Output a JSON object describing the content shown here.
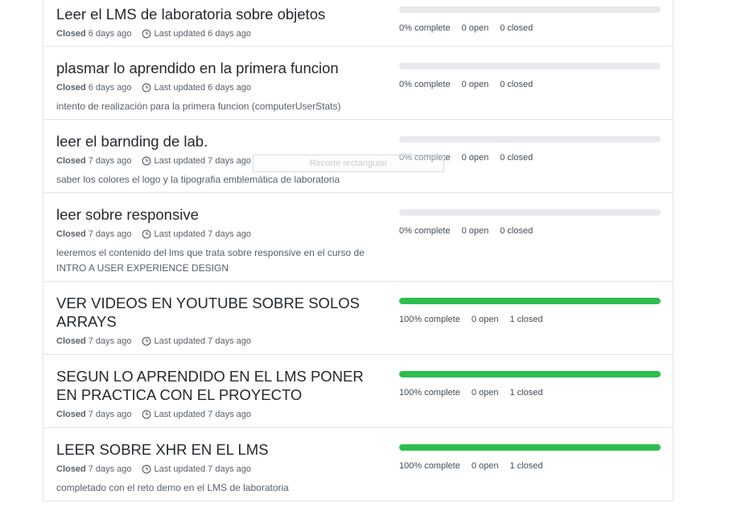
{
  "milestones": [
    {
      "title": "Leer el LMS de laboratoria sobre objetos",
      "state": "Closed",
      "closed_ago": "6 days ago",
      "updated": "Last updated 6 days ago",
      "description": "",
      "progress": 0,
      "complete": "0% complete",
      "open": "0 open",
      "closed": "0 closed"
    },
    {
      "title": "plasmar lo aprendido en la primera funcion",
      "state": "Closed",
      "closed_ago": "6 days ago",
      "updated": "Last updated 6 days ago",
      "description": "intento de realización para la primera funcion (computerUserStats)",
      "progress": 0,
      "complete": "0% complete",
      "open": "0 open",
      "closed": "0 closed"
    },
    {
      "title": "leer el barnding de lab.",
      "state": "Closed",
      "closed_ago": "7 days ago",
      "updated": "Last updated 7 days ago",
      "description": "saber los colores el logo y la tipografia emblemática de laboratoria",
      "progress": 0,
      "complete": "0% complete",
      "open": "0 open",
      "closed": "0 closed"
    },
    {
      "title": "leer sobre responsive",
      "state": "Closed",
      "closed_ago": "7 days ago",
      "updated": "Last updated 7 days ago",
      "description": "leeremos el contenido del lms que trata sobre responsive en el curso de INTRO A USER EXPERIENCE DESIGN",
      "progress": 0,
      "complete": "0% complete",
      "open": "0 open",
      "closed": "0 closed"
    },
    {
      "title": "VER VIDEOS EN YOUTUBE SOBRE SOLOS ARRAYS",
      "state": "Closed",
      "closed_ago": "7 days ago",
      "updated": "Last updated 7 days ago",
      "description": "",
      "progress": 100,
      "complete": "100% complete",
      "open": "0 open",
      "closed": "1 closed"
    },
    {
      "title": "SEGUN LO APRENDIDO EN EL LMS PONER EN PRACTICA CON EL PROYECTO",
      "state": "Closed",
      "closed_ago": "7 days ago",
      "updated": "Last updated 7 days ago",
      "description": "",
      "progress": 100,
      "complete": "100% complete",
      "open": "0 open",
      "closed": "1 closed"
    },
    {
      "title": "LEER SOBRE XHR EN EL LMS",
      "state": "Closed",
      "closed_ago": "7 days ago",
      "updated": "Last updated 7 days ago",
      "description": "completado con el reto demo en el LMS de laboratoria",
      "progress": 100,
      "complete": "100% complete",
      "open": "0 open",
      "closed": "1 closed"
    }
  ],
  "overlay_label": "Recorte rectangular",
  "icons": {
    "updated": "clock-icon"
  },
  "colors": {
    "progress_fill": "#2cbe4e",
    "progress_track": "#e8e9ed",
    "border": "#e1e4e8"
  }
}
